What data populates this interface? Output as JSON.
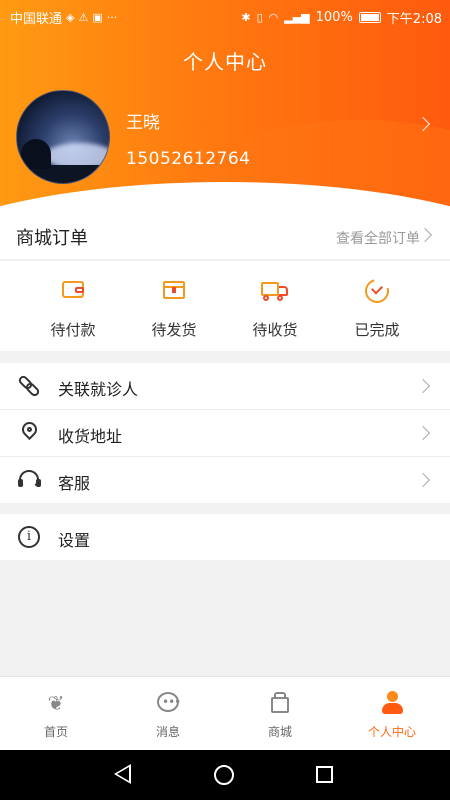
{
  "status_bar": {
    "carrier": "中国联通",
    "battery": "100%",
    "time": "下午2:08"
  },
  "header": {
    "title": "个人中心",
    "user_name": "王晓",
    "user_phone": "15052612764"
  },
  "orders": {
    "title": "商城订单",
    "view_all": "查看全部订单",
    "items": [
      {
        "label": "待付款",
        "icon": "wallet-icon"
      },
      {
        "label": "待发货",
        "icon": "package-icon"
      },
      {
        "label": "待收货",
        "icon": "truck-icon"
      },
      {
        "label": "已完成",
        "icon": "check-circle-icon"
      }
    ]
  },
  "menu": {
    "group1": [
      {
        "label": "关联就诊人",
        "icon": "link-icon"
      },
      {
        "label": "收货地址",
        "icon": "location-pin-icon"
      },
      {
        "label": "客服",
        "icon": "headset-icon"
      }
    ],
    "group2": [
      {
        "label": "设置",
        "icon": "info-icon"
      }
    ]
  },
  "tabbar": {
    "items": [
      {
        "label": "首页",
        "icon": "home-icon",
        "active": false
      },
      {
        "label": "消息",
        "icon": "message-icon",
        "active": false
      },
      {
        "label": "商城",
        "icon": "mall-icon",
        "active": false
      },
      {
        "label": "个人中心",
        "icon": "profile-icon",
        "active": true
      }
    ]
  },
  "colors": {
    "brand_orange": "#ff7a10",
    "active_tab": "#ff6a12"
  }
}
